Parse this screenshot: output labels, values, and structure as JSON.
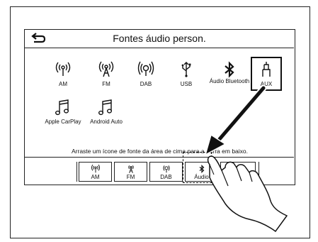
{
  "header": {
    "title": "Fontes áudio person.",
    "back_icon": "back-arrow-icon"
  },
  "sources": [
    {
      "label": "AM",
      "icon": "radio-wave-icon"
    },
    {
      "label": "FM",
      "icon": "radio-wave-icon"
    },
    {
      "label": "DAB",
      "icon": "radio-wave-icon"
    },
    {
      "label": "USB",
      "icon": "usb-icon"
    },
    {
      "label": "Áudio Bluetooth",
      "icon": "bluetooth-icon"
    },
    {
      "label": "AUX",
      "icon": "aux-plug-icon"
    },
    {
      "label": "Apple CarPlay",
      "icon": "music-note-icon"
    },
    {
      "label": "Android Auto",
      "icon": "music-note-icon"
    }
  ],
  "hint": "Arraste um ícone de fonte da área de cima para a barra em baixo.",
  "bar": [
    {
      "label": "AM"
    },
    {
      "label": "FM"
    },
    {
      "label": "DAB"
    },
    {
      "label": "Áudio"
    }
  ]
}
